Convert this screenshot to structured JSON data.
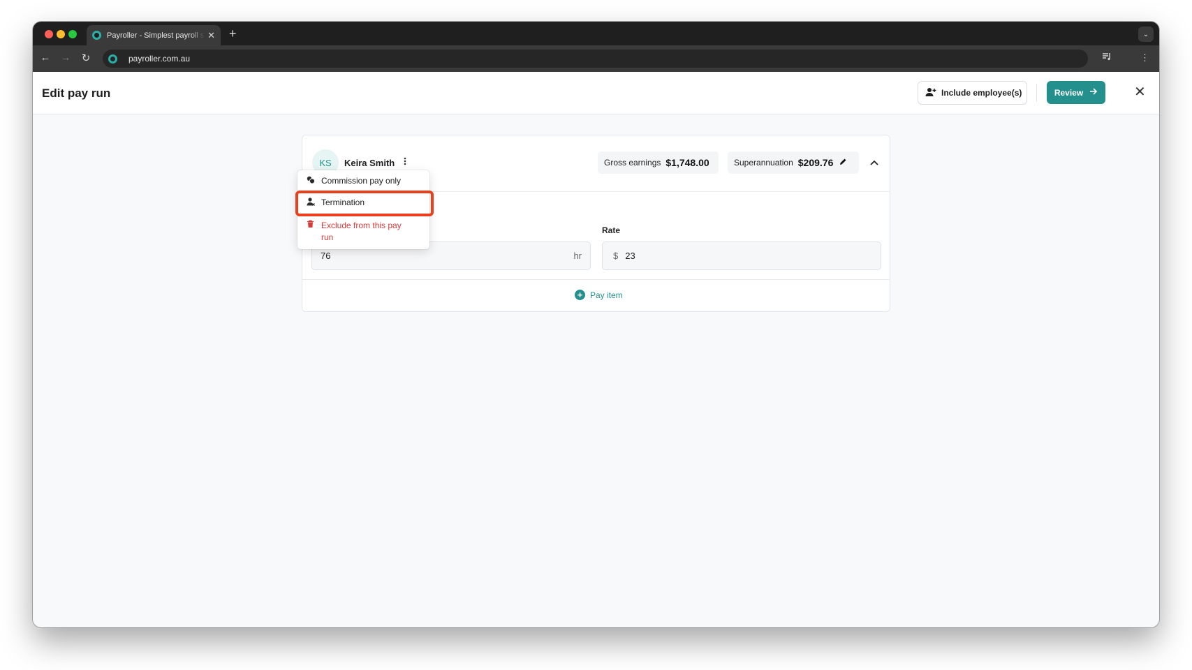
{
  "browser": {
    "tab_title": "Payroller - Simplest payroll so",
    "tab_close": "✕",
    "new_tab": "+",
    "tab_menu": "⌄",
    "url": "payroller.com.au",
    "back": "←",
    "forward": "→",
    "reload": "↻",
    "kebab": "⋮"
  },
  "header": {
    "title": "Edit pay run",
    "include_label": "Include employee(s)",
    "review_label": "Review",
    "close": "✕"
  },
  "employee": {
    "initials": "KS",
    "name": "Keira Smith",
    "gross_label": "Gross earnings",
    "gross_value": "$1,748.00",
    "super_label": "Superannuation",
    "super_value": "$209.76"
  },
  "menu": {
    "items": [
      {
        "label": "Commission pay only",
        "icon": "coins-icon"
      },
      {
        "label": "Termination",
        "icon": "user-remove-icon"
      },
      {
        "label": "Exclude from this pay run",
        "icon": "trash-icon"
      }
    ]
  },
  "payline": {
    "hours_value": "76",
    "hours_unit": "hr",
    "rate_label": "Rate",
    "rate_currency": "$",
    "rate_value": "23"
  },
  "footer": {
    "pay_item_label": "Pay item"
  },
  "colors": {
    "accent": "#23908d",
    "danger": "#d63b3b",
    "highlight": "#e8401e"
  }
}
